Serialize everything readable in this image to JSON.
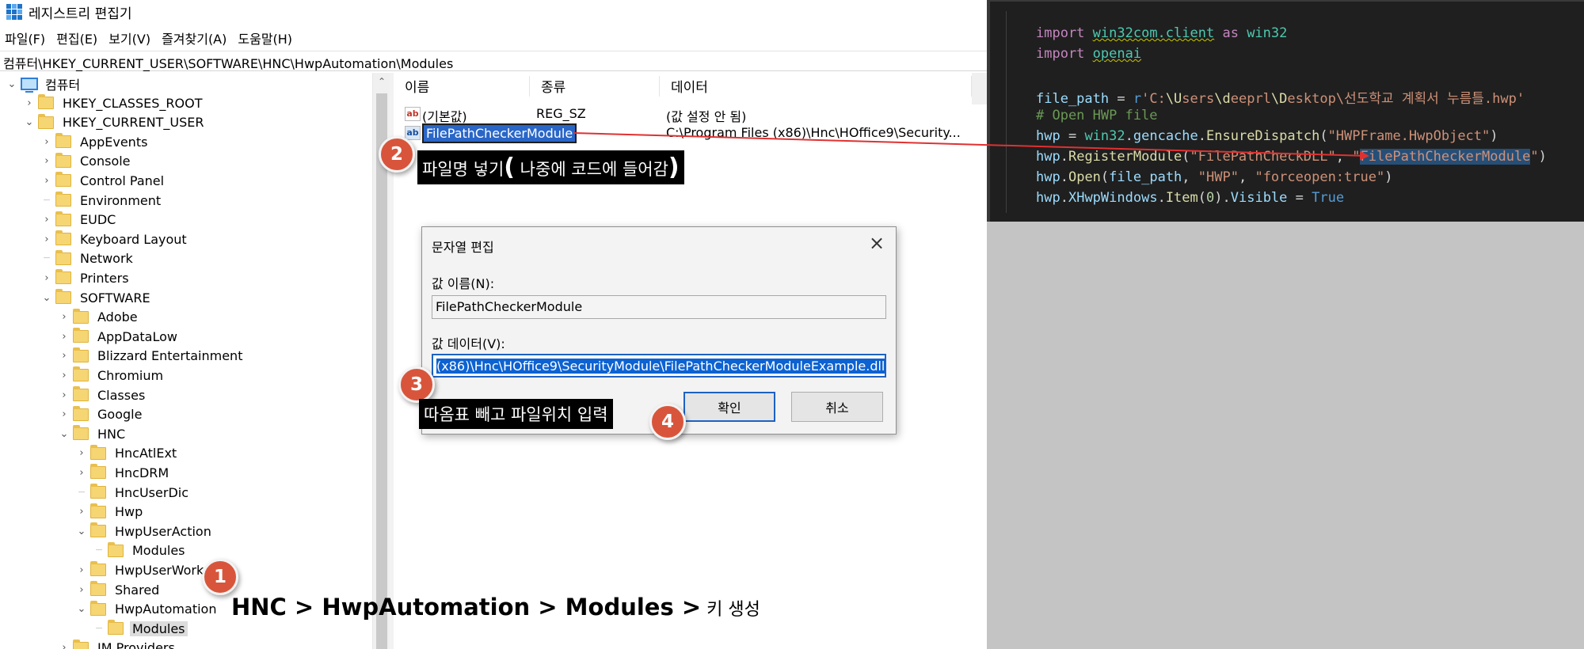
{
  "window": {
    "title": "레지스트리 편집기"
  },
  "menu": [
    "파일(F)",
    "편집(E)",
    "보기(V)",
    "즐겨찾기(A)",
    "도움말(H)"
  ],
  "address": "컴퓨터\\HKEY_CURRENT_USER\\SOFTWARE\\HNC\\HwpAutomation\\Modules",
  "tree": {
    "root": "컴퓨터",
    "items": [
      {
        "label": "HKEY_CLASSES_ROOT",
        "chevron": "right"
      },
      {
        "label": "HKEY_CURRENT_USER",
        "chevron": "down"
      },
      {
        "label": "AppEvents",
        "chevron": "right"
      },
      {
        "label": "Console",
        "chevron": "right"
      },
      {
        "label": "Control Panel",
        "chevron": "right"
      },
      {
        "label": "Environment",
        "chevron": "none"
      },
      {
        "label": "EUDC",
        "chevron": "right"
      },
      {
        "label": "Keyboard Layout",
        "chevron": "right"
      },
      {
        "label": "Network",
        "chevron": "none"
      },
      {
        "label": "Printers",
        "chevron": "right"
      },
      {
        "label": "SOFTWARE",
        "chevron": "down"
      },
      {
        "label": "Adobe",
        "chevron": "right"
      },
      {
        "label": "AppDataLow",
        "chevron": "right"
      },
      {
        "label": "Blizzard Entertainment",
        "chevron": "right"
      },
      {
        "label": "Chromium",
        "chevron": "right"
      },
      {
        "label": "Classes",
        "chevron": "right"
      },
      {
        "label": "Google",
        "chevron": "right"
      },
      {
        "label": "HNC",
        "chevron": "down"
      },
      {
        "label": "HncAtlExt",
        "chevron": "right"
      },
      {
        "label": "HncDRM",
        "chevron": "right"
      },
      {
        "label": "HncUserDic",
        "chevron": "none"
      },
      {
        "label": "Hwp",
        "chevron": "right"
      },
      {
        "label": "HwpUserAction",
        "chevron": "down"
      },
      {
        "label": "Modules",
        "chevron": "none"
      },
      {
        "label": "HwpUserWorks",
        "chevron": "right"
      },
      {
        "label": "Shared",
        "chevron": "right"
      },
      {
        "label": "HwpAutomation",
        "chevron": "down"
      },
      {
        "label": "Modules",
        "chevron": "none"
      },
      {
        "label": "IM Providers",
        "chevron": "right"
      }
    ]
  },
  "values": {
    "headers": [
      "이름",
      "종류",
      "데이터"
    ],
    "rows": [
      {
        "name": "(기본값)",
        "type": "REG_SZ",
        "data": "(값 설정 안 됨)"
      },
      {
        "name": "FilePathCheckerModule",
        "type": "",
        "data": "C:\\Program Files (x86)\\Hnc\\HOffice9\\Security..."
      }
    ]
  },
  "dialog": {
    "title": "문자열 편집",
    "name_label": "값 이름(N):",
    "name_value": "FilePathCheckerModule",
    "data_label": "값 데이터(V):",
    "data_value": "(x86)\\Hnc\\HOffice9\\SecurityModule\\FilePathCheckerModuleExample.dll",
    "ok": "확인",
    "cancel": "취소"
  },
  "annotations": {
    "markers": [
      "1",
      "2",
      "3",
      "4"
    ],
    "callout_filename": {
      "pre": "파일명 넣기",
      "open": "(",
      "mid": " 나중에  코드에 들어감",
      "close": ")"
    },
    "callout_path": "따옴표 빼고 파일위치 입력",
    "path_caption_bold": "HNC > HwpAutomation > Modules >",
    "path_caption_tail": " 키 생성"
  },
  "code": {
    "line1_kw": "import",
    "line1_mod": "win32com.client",
    "line1_as": "as",
    "line1_alias": "win32",
    "line2_kw": "import",
    "line2_mod": "openai",
    "line3_var": "file_path",
    "line3_eq": " = ",
    "line3_prefix": "r",
    "line3_str_a": "'C:",
    "line3_str_b": "\\U",
    "line3_str_c": "sers",
    "line3_str_d": "\\d",
    "line3_str_e": "eeprl",
    "line3_str_f": "\\D",
    "line3_str_g": "esktop",
    "line3_str_h": "\\선도학교 계획서 누름틀.hwp'",
    "line4_comment": "# Open HWP file",
    "line5_var": "hwp",
    "line5_eq": " = ",
    "line5_obj": "win32",
    "line5_dot1": ".",
    "line5_attr": "gencache",
    "line5_dot2": ".",
    "line5_fn": "EnsureDispatch",
    "line5_p1": "(",
    "line5_str": "\"HWPFrame.HwpObject\"",
    "line5_p2": ")",
    "line6_var": "hwp",
    "line6_dot": ".",
    "line6_fn": "RegisterModule",
    "line6_p1": "(",
    "line6_str1": "\"FilePathCheckDLL\"",
    "line6_comma": ", ",
    "line6_q1": "\"",
    "line6_hl": "FilePathCheckerModule",
    "line6_q2": "\"",
    "line6_p2": ")",
    "line7_var": "hwp",
    "line7_dot": ".",
    "line7_fn": "Open",
    "line7_p1": "(",
    "line7_arg": "file_path",
    "line7_comma1": ", ",
    "line7_str1": "\"HWP\"",
    "line7_comma2": ", ",
    "line7_str2": "\"forceopen:true\"",
    "line7_p2": ")",
    "line8_var": "hwp",
    "line8_dot1": ".",
    "line8_attr": "XHwpWindows",
    "line8_dot2": ".",
    "line8_fn": "Item",
    "line8_p1": "(",
    "line8_num": "0",
    "line8_p2": ").",
    "line8_attr2": "Visible",
    "line8_eq": " = ",
    "line8_bool": "True"
  },
  "colors": {
    "annotation_marker": "#d8553b",
    "arrow": "#e03131",
    "selection": "#0d62d2",
    "code_background": "#1f1f1f"
  }
}
